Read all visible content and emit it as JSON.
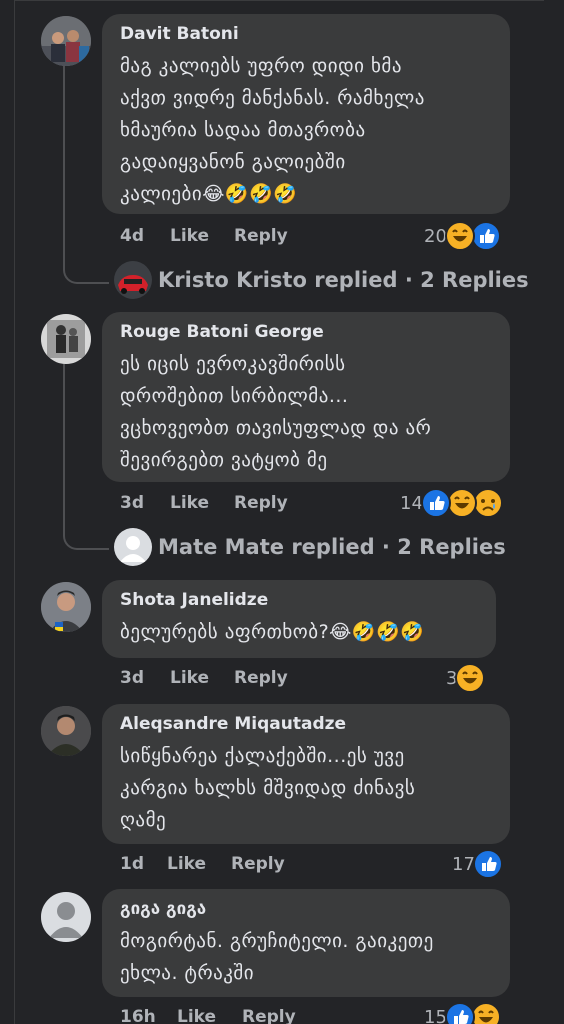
{
  "colors": {
    "background": "#232427",
    "bubble": "#3a3b3c",
    "text": "#e4e6eb",
    "muted": "#b0b3b8",
    "like_blue": "#1b74e4",
    "haha_yellow": "#f7b125"
  },
  "comments": [
    {
      "author": "Davit Batoni",
      "text": "მაგ კალიებს უფრო დიდი ხმა აქვთ ვიდრე მანქანას. რამხელა ხმაურია სადაა მთავრობა გადაიყვანონ გალიებში კალიები😂🤣🤣🤣",
      "lines": [
        "მაგ კალიებს უფრო დიდი ხმა",
        "აქვთ ვიდრე მანქანას. რამხელა",
        "ხმაურია სადაა მთავრობა",
        "გადაიყვანონ გალიებში",
        "კალიები😂🤣🤣🤣"
      ],
      "time": "4d",
      "like": "Like",
      "reply": "Reply",
      "reaction_count": "20",
      "reactions": [
        "haha-icon",
        "like-icon"
      ],
      "replied": "Kristo Kristo replied · 2 Replies"
    },
    {
      "author": "Rouge Batoni George",
      "lines": [
        "ეს იცის ევროკავშირისს",
        "დროშებით სირბილმა...",
        "ვცხოვეობთ თავისუფლად და არ",
        "შევირგებთ ვატყობ მე"
      ],
      "time": "3d",
      "like": "Like",
      "reply": "Reply",
      "reaction_count": "14",
      "reactions": [
        "like-icon",
        "haha-icon",
        "sad-icon"
      ],
      "replied": "Mate Mate replied · 2 Replies"
    },
    {
      "author": "Shota Janelidze",
      "lines": [
        "ბელურებს აფრთხობ?😂🤣🤣🤣"
      ],
      "time": "3d",
      "like": "Like",
      "reply": "Reply",
      "reaction_count": "3",
      "reactions": [
        "haha-icon"
      ]
    },
    {
      "author": "Aleqsandre Miqautadze",
      "lines": [
        "სიწყნარეა ქალაქებში...ეს უვე",
        "კარგია ხალხს მშვიდად ძინავს",
        "ღამე"
      ],
      "time": "1d",
      "like": "Like",
      "reply": "Reply",
      "reaction_count": "17",
      "reactions": [
        "like-icon"
      ]
    },
    {
      "author": "გიგა გიგა",
      "lines": [
        "მოგირტან. გრუჩიტელი. გაიკეთე",
        "ეხლა. ტრაკში"
      ],
      "time": "16h",
      "like": "Like",
      "reply": "Reply",
      "reaction_count": "15",
      "reactions": [
        "like-icon",
        "haha-icon"
      ]
    }
  ]
}
